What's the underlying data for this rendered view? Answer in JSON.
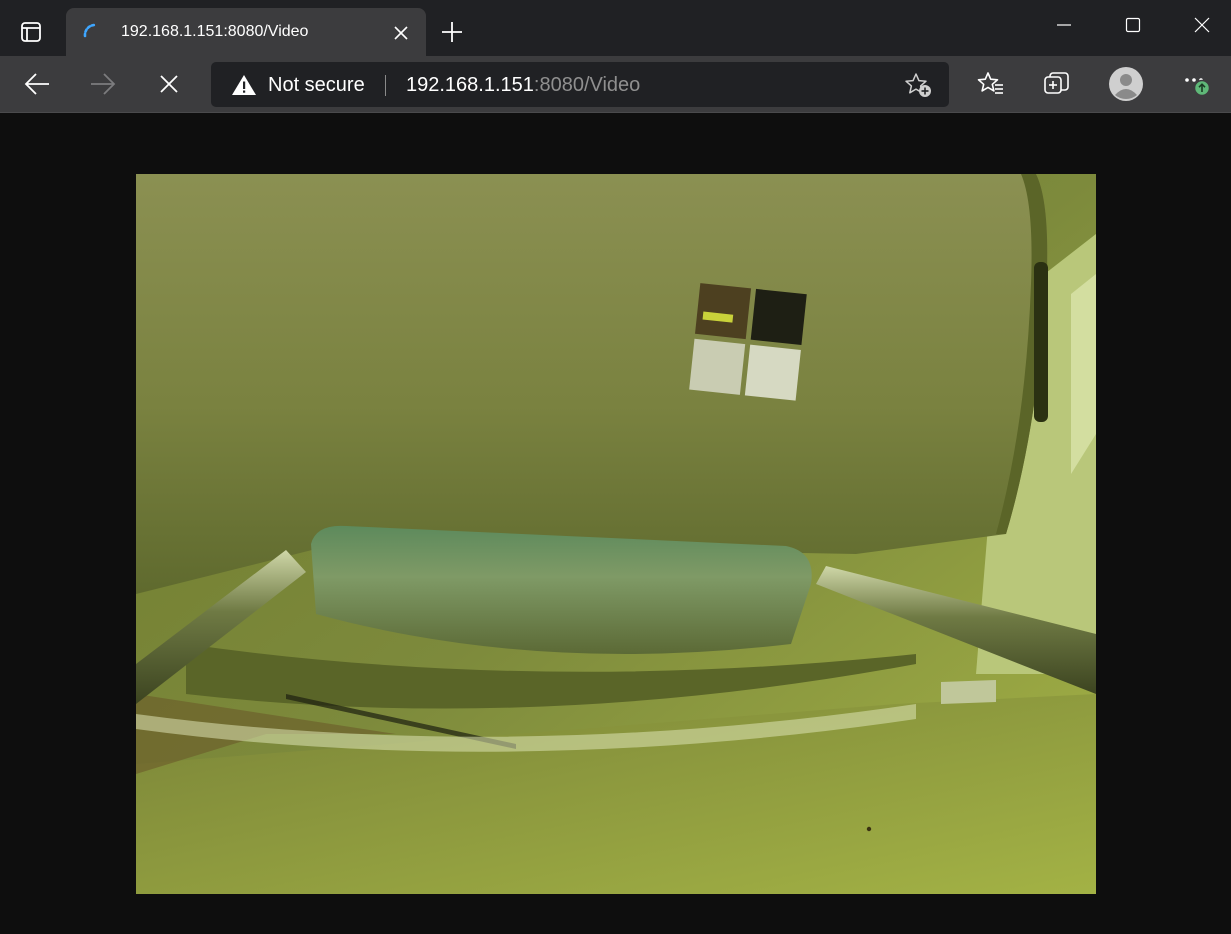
{
  "browser": {
    "tab": {
      "title": "192.168.1.151:8080/Video",
      "loading": true
    },
    "address_bar": {
      "security_label": "Not secure",
      "url_host": "192.168.1.151",
      "url_rest": ":8080/Video"
    },
    "icons": {
      "tab_actions": "tab-actions-icon",
      "tab_close": "close-icon",
      "new_tab": "plus-icon",
      "minimize": "minimize-icon",
      "maximize": "maximize-icon",
      "close_window": "close-icon",
      "back": "arrow-left-icon",
      "forward": "arrow-right-icon",
      "stop": "close-icon",
      "warning": "warning-icon",
      "add_favorite": "star-plus-icon",
      "favorites": "favorites-icon",
      "collections": "collections-icon",
      "profile": "avatar-icon",
      "menu": "more-icon",
      "update_badge": "update-arrow-icon"
    },
    "colors": {
      "title_bar": "#202124",
      "toolbar": "#3c3c3e",
      "address_bar": "#202124",
      "page_background": "#0e0e0e",
      "spinner": "#3ea6ff",
      "update_badge": "#5fb878"
    }
  },
  "page": {
    "content": "video-stream-frame"
  }
}
